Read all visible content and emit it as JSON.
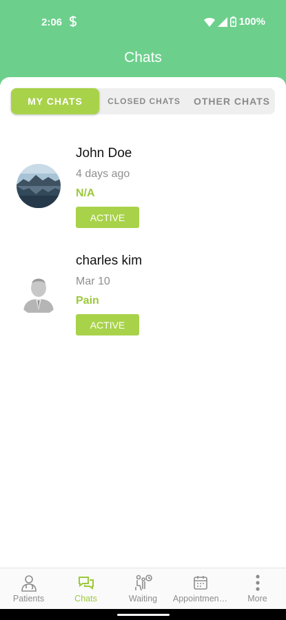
{
  "status_bar": {
    "time": "2:06",
    "battery": "100%",
    "sim_icon": "s-icon"
  },
  "header": {
    "title": "Chats"
  },
  "tabs": [
    {
      "label": "MY CHATS",
      "active": true
    },
    {
      "label": "CLOSED CHATS",
      "active": false
    },
    {
      "label": "OTHER CHATS",
      "active": false
    }
  ],
  "chats": [
    {
      "name": "John Doe",
      "time": "4 days ago",
      "topic": "N/A",
      "status": "ACTIVE",
      "avatar": "landscape-photo"
    },
    {
      "name": "charles kim",
      "time": "Mar 10",
      "topic": "Pain",
      "status": "ACTIVE",
      "avatar": "default-user-avatar"
    }
  ],
  "bottom_nav": [
    {
      "label": "Patients",
      "icon": "doctor-icon",
      "active": false
    },
    {
      "label": "Chats",
      "icon": "chat-icon",
      "active": true
    },
    {
      "label": "Waiting",
      "icon": "waiting-icon",
      "active": false
    },
    {
      "label": "Appointmen…",
      "icon": "calendar-icon",
      "active": false
    },
    {
      "label": "More",
      "icon": "more-vertical-icon",
      "active": false
    }
  ],
  "colors": {
    "header": "#6cd08c",
    "accent": "#a8d24a",
    "topic_text": "#9bc93a"
  }
}
